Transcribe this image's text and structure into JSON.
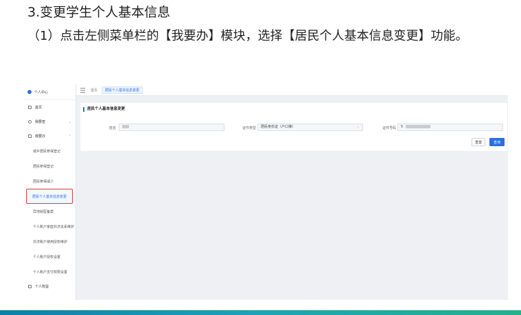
{
  "slide": {
    "title": "3.变更学生个人基本信息",
    "body": "（1）点击左侧菜单栏的【我要办】模块，选择【居民个人基本信息变更】功能。"
  },
  "sidebar": {
    "header": "个人中心",
    "items": [
      {
        "label": "首页",
        "chevron": ""
      },
      {
        "label": "我要查",
        "chevron": "⌄"
      },
      {
        "label": "我要办",
        "chevron": "⌃"
      }
    ],
    "sub_items": [
      "城乡居民参保登记",
      "居民参保登记",
      "居民参保减少",
      "居民个人基本信息变更",
      "异地就医备案",
      "个人账户家庭共济关系维护",
      "共济账户使用授权维护",
      "个人账户授权设置",
      "个人账户支付权限设置"
    ],
    "active_index": 3,
    "footer": "个人权益"
  },
  "topbar": {
    "crumb": "首页",
    "tab": "居民个人基本信息变更"
  },
  "panel": {
    "title": "居民个人基本信息变更",
    "name_label": "姓名",
    "id_type_label": "证件类型",
    "id_type_value": "居民身份证（户口簿）",
    "id_no_label": "证件号码",
    "id_no_prefix": "5",
    "reset_label": "重置",
    "query_label": "查询"
  },
  "colors": {
    "accent": "#2d6ee0",
    "highlight_border": "#e23a2e"
  }
}
